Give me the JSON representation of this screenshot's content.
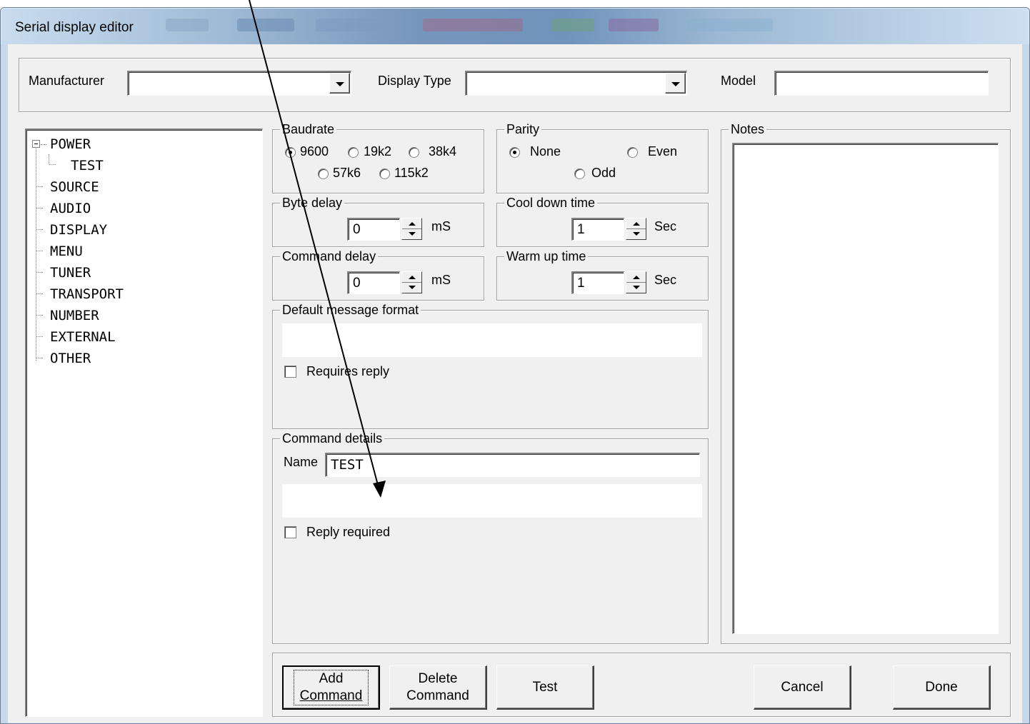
{
  "window": {
    "title": "Serial display editor"
  },
  "header": {
    "manufacturer_label": "Manufacturer",
    "manufacturer_value": "",
    "display_type_label": "Display Type",
    "display_type_value": "",
    "model_label": "Model",
    "model_value": ""
  },
  "tree": {
    "items": [
      {
        "label": "POWER",
        "level": 0,
        "expanded": true
      },
      {
        "label": "TEST",
        "level": 1
      },
      {
        "label": "SOURCE",
        "level": 0
      },
      {
        "label": "AUDIO",
        "level": 0
      },
      {
        "label": "DISPLAY",
        "level": 0
      },
      {
        "label": "MENU",
        "level": 0
      },
      {
        "label": "TUNER",
        "level": 0
      },
      {
        "label": "TRANSPORT",
        "level": 0
      },
      {
        "label": "NUMBER",
        "level": 0
      },
      {
        "label": "EXTERNAL",
        "level": 0
      },
      {
        "label": "OTHER",
        "level": 0
      }
    ]
  },
  "baudrate": {
    "label": "Baudrate",
    "options": [
      "9600",
      "19k2",
      "38k4",
      "57k6",
      "115k2"
    ],
    "selected": "9600"
  },
  "parity": {
    "label": "Parity",
    "options": [
      "None",
      "Even",
      "Odd"
    ],
    "selected": "None"
  },
  "byte_delay": {
    "label": "Byte delay",
    "value": "0",
    "unit": "mS"
  },
  "cool_down": {
    "label": "Cool down time",
    "value": "1",
    "unit": "Sec"
  },
  "command_delay": {
    "label": "Command delay",
    "value": "0",
    "unit": "mS"
  },
  "warm_up": {
    "label": "Warm up time",
    "value": "1",
    "unit": "Sec"
  },
  "default_format": {
    "label": "Default message format",
    "value": "",
    "requires_reply_label": "Requires reply",
    "requires_reply_checked": false
  },
  "command_details": {
    "label": "Command details",
    "name_label": "Name",
    "name_value": "TEST",
    "command_value": "",
    "reply_required_label": "Reply required",
    "reply_required_checked": false
  },
  "notes": {
    "label": "Notes",
    "value": ""
  },
  "buttons": {
    "add_line1": "Add",
    "add_line2": "Command",
    "delete_line1": "Delete",
    "delete_line2": "Command",
    "test": "Test",
    "cancel": "Cancel",
    "done": "Done"
  }
}
